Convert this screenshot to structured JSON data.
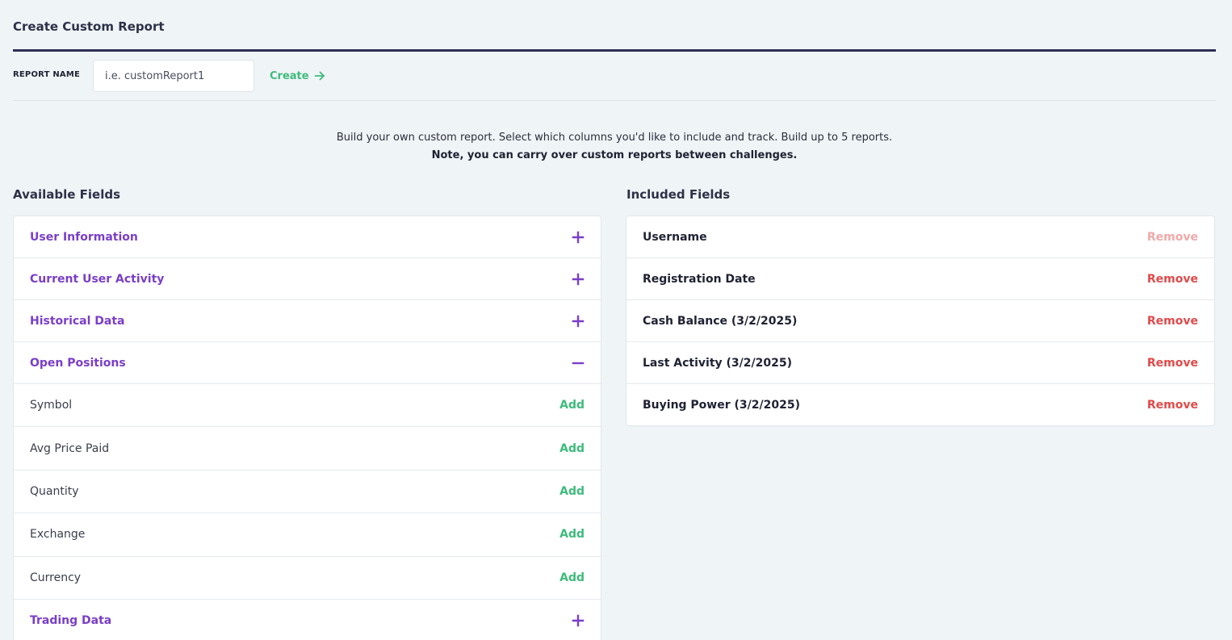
{
  "page": {
    "title": "Create Custom Report"
  },
  "report_name": {
    "label": "REPORT NAME",
    "placeholder": "i.e. customReport1",
    "value": "",
    "create_label": "Create"
  },
  "intro": {
    "line1": "Build your own custom report. Select which columns you'd like to include and track. Build up to 5 reports.",
    "line2": "Note, you can carry over custom reports between challenges."
  },
  "available": {
    "title": "Available Fields",
    "add_label": "Add",
    "categories": [
      {
        "label": "User Information",
        "expanded": false,
        "icon": "plus-icon"
      },
      {
        "label": "Current User Activity",
        "expanded": false,
        "icon": "plus-icon"
      },
      {
        "label": "Historical Data",
        "expanded": false,
        "icon": "plus-icon"
      },
      {
        "label": "Open Positions",
        "expanded": true,
        "icon": "minus-icon",
        "fields": [
          "Symbol",
          "Avg Price Paid",
          "Quantity",
          "Exchange",
          "Currency"
        ]
      },
      {
        "label": "Trading Data",
        "expanded": false,
        "icon": "plus-icon"
      }
    ]
  },
  "included": {
    "title": "Included Fields",
    "remove_label": "Remove",
    "fields": [
      {
        "label": "Username",
        "removable": false
      },
      {
        "label": "Registration Date",
        "removable": true
      },
      {
        "label": "Cash Balance (3/2/2025)",
        "removable": true
      },
      {
        "label": "Last Activity (3/2/2025)",
        "removable": true
      },
      {
        "label": "Buying Power (3/2/2025)",
        "removable": true
      }
    ]
  },
  "colors": {
    "accent_purple": "#7a3ec9",
    "add_green": "#3dbb7b",
    "remove_red": "#e04a4a",
    "remove_disabled": "#f0a8a8",
    "title_rule": "#2d2f55",
    "background": "#eff4f7"
  }
}
